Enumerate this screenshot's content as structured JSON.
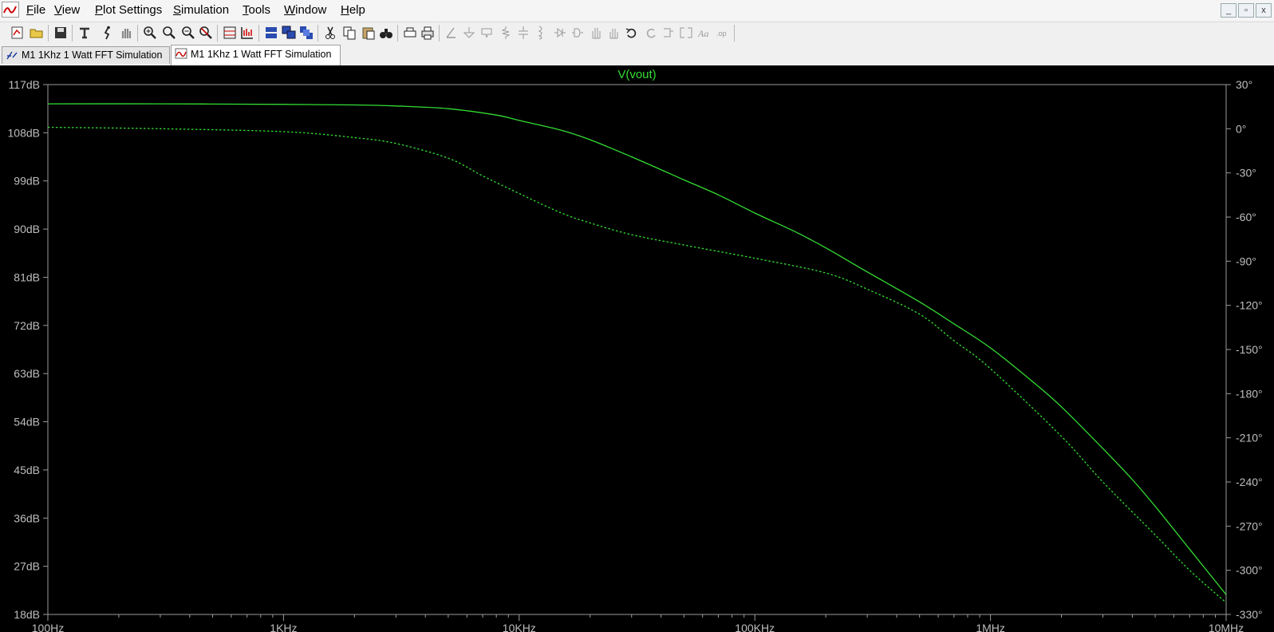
{
  "menu": [
    "File",
    "View",
    "Plot Settings",
    "Simulation",
    "Tools",
    "Window",
    "Help"
  ],
  "window_controls": {
    "minimize": "_",
    "restore": "▫",
    "close": "x"
  },
  "tabs": [
    {
      "label": "M1 1Khz 1 Watt FFT Simulation",
      "kind": "schematic",
      "active": false
    },
    {
      "label": "M1 1Khz 1 Watt FFT Simulation",
      "kind": "waveform",
      "active": true
    }
  ],
  "toolbar": [
    "new-schematic",
    "open",
    "save",
    "control-panel",
    "run",
    "halt",
    "zoom-in",
    "zoom-pan",
    "zoom-out",
    "zoom-fit",
    "autorange",
    "view-fft",
    "tile-horizontal",
    "cascade",
    "tile-vertical",
    "cut",
    "copy",
    "paste",
    "find",
    "print-setup",
    "print",
    "draw-wire",
    "ground",
    "label-net",
    "resistor",
    "capacitor",
    "inductor",
    "diode",
    "component",
    "move",
    "drag",
    "undo",
    "redo",
    "rotate",
    "mirror",
    "text",
    "spice-directive"
  ],
  "chart_data": {
    "type": "line",
    "title": "V(vout)",
    "x_scale": "log",
    "xlim": [
      100,
      10000000
    ],
    "x_ticks": [
      {
        "value": 100,
        "label": "100Hz"
      },
      {
        "value": 1000,
        "label": "1KHz"
      },
      {
        "value": 10000,
        "label": "10KHz"
      },
      {
        "value": 100000,
        "label": "100KHz"
      },
      {
        "value": 1000000,
        "label": "1MHz"
      },
      {
        "value": 10000000,
        "label": "10MHz"
      }
    ],
    "y_left": {
      "unit": "dB",
      "lim": [
        18,
        117
      ],
      "ticks": [
        "117dB",
        "108dB",
        "99dB",
        "90dB",
        "81dB",
        "72dB",
        "63dB",
        "54dB",
        "45dB",
        "36dB",
        "27dB",
        "18dB"
      ]
    },
    "y_right": {
      "unit": "°",
      "lim": [
        -330,
        30
      ],
      "ticks": [
        "30°",
        "0°",
        "-30°",
        "-60°",
        "-90°",
        "-120°",
        "-150°",
        "-180°",
        "-210°",
        "-240°",
        "-270°",
        "-300°",
        "-330°"
      ]
    },
    "series": [
      {
        "name": "V(vout)",
        "style": "solid",
        "color": "#33dd33",
        "axis": "left",
        "points": [
          [
            100,
            113.4
          ],
          [
            300,
            113.4
          ],
          [
            1000,
            113.3
          ],
          [
            2000,
            113.2
          ],
          [
            3000,
            113.0
          ],
          [
            5000,
            112.5
          ],
          [
            8000,
            111.3
          ],
          [
            10000,
            110.3
          ],
          [
            15000,
            108.5
          ],
          [
            20000,
            106.7
          ],
          [
            30000,
            103.5
          ],
          [
            50000,
            99.2
          ],
          [
            70000,
            96.4
          ],
          [
            100000,
            93.0
          ],
          [
            150000,
            89.4
          ],
          [
            200000,
            86.5
          ],
          [
            300000,
            82.0
          ],
          [
            500000,
            76.4
          ],
          [
            700000,
            72.3
          ],
          [
            1000000,
            67.8
          ],
          [
            1500000,
            61.6
          ],
          [
            2000000,
            56.8
          ],
          [
            3000000,
            49.0
          ],
          [
            4000000,
            43.2
          ],
          [
            5000000,
            38.2
          ],
          [
            7000000,
            30.2
          ],
          [
            10000000,
            21.7
          ]
        ]
      },
      {
        "name": "",
        "style": "dashed",
        "color": "#33dd33",
        "axis": "right",
        "points": [
          [
            100,
            1
          ],
          [
            300,
            0
          ],
          [
            1000,
            -2
          ],
          [
            2000,
            -6
          ],
          [
            3000,
            -10
          ],
          [
            5000,
            -20
          ],
          [
            7000,
            -32
          ],
          [
            10000,
            -44
          ],
          [
            15000,
            -57
          ],
          [
            20000,
            -64
          ],
          [
            30000,
            -72
          ],
          [
            50000,
            -79
          ],
          [
            100000,
            -88
          ],
          [
            200000,
            -98
          ],
          [
            300000,
            -109
          ],
          [
            500000,
            -126
          ],
          [
            700000,
            -144
          ],
          [
            1000000,
            -163
          ],
          [
            2000000,
            -209
          ],
          [
            3000000,
            -240
          ],
          [
            5000000,
            -276
          ],
          [
            7000000,
            -300
          ],
          [
            10000000,
            -322
          ]
        ]
      }
    ]
  }
}
